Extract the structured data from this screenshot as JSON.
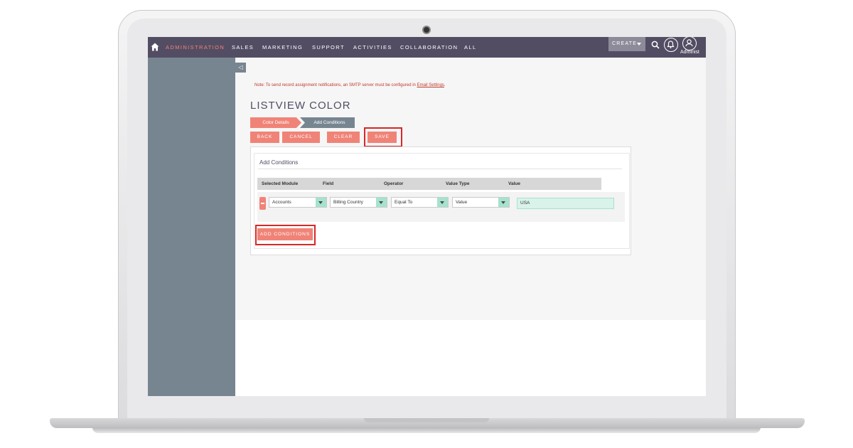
{
  "nav": {
    "items": [
      "ADMINISTRATION",
      "SALES",
      "MARKETING",
      "SUPPORT",
      "ACTIVITIES",
      "COLLABORATION",
      "ALL"
    ],
    "active_index": 0,
    "create_label": "CREATE",
    "user_label": "Administ",
    "accent_color": "#f08377",
    "bar_color": "#534d64"
  },
  "sidebar": {
    "collapse_icon": "◁"
  },
  "notice": {
    "text": "Note: To send record assignment notifications, an SMTP server must be configured in ",
    "link_text": "Email Settings",
    "end": "."
  },
  "page": {
    "title": "LISTVIEW COLOR"
  },
  "steps": [
    "Color Details",
    "Add Conditions"
  ],
  "actions": {
    "back": "BACK",
    "cancel": "CANCEL",
    "clear": "CLEAR",
    "save": "SAVE"
  },
  "conditions": {
    "title": "Add Conditions",
    "headers": [
      "Selected Module",
      "Field",
      "Operator",
      "Value Type",
      "Value"
    ],
    "row": {
      "module": "Accounts",
      "field": "Billing Country",
      "operator": "Equal To",
      "value_type": "Value",
      "value": "USA"
    },
    "add_button": "ADD CONDITIONS"
  }
}
